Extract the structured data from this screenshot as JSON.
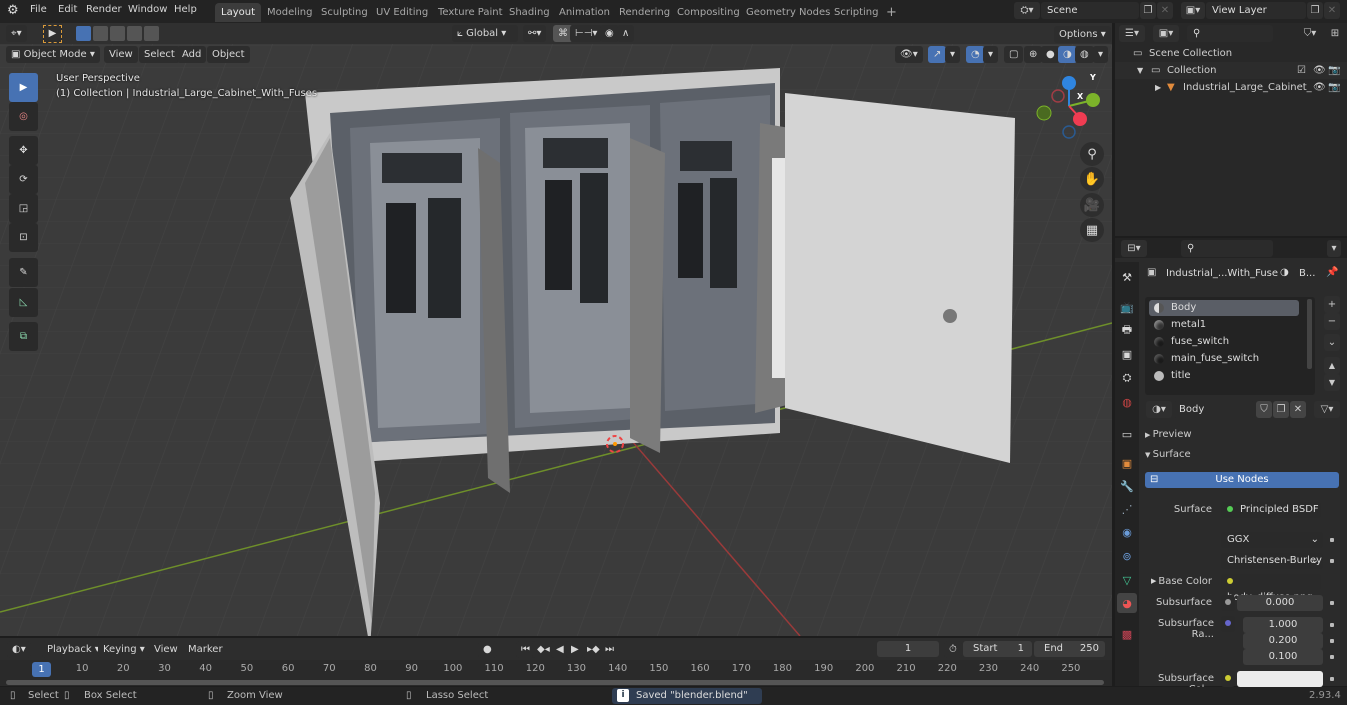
{
  "menubar": {
    "items": [
      "File",
      "Edit",
      "Render",
      "Window",
      "Help"
    ],
    "workspaces": [
      "Layout",
      "Modeling",
      "Sculpting",
      "UV Editing",
      "Texture Paint",
      "Shading",
      "Animation",
      "Rendering",
      "Compositing",
      "Geometry Nodes",
      "Scripting"
    ],
    "active_workspace": "Layout",
    "add_workspace": "+",
    "scene_name": "Scene",
    "view_layer": "View Layer"
  },
  "viewport": {
    "mode": "Object Mode",
    "menus": [
      "View",
      "Select",
      "Add",
      "Object"
    ],
    "orientation": "Global",
    "options_label": "Options",
    "overlay_title": "User Perspective",
    "overlay_subtitle": "(1) Collection | Industrial_Large_Cabinet_With_Fuses",
    "gizmo_axes": {
      "x": "X",
      "y": "Y",
      "z": "Z"
    },
    "axis_colors": {
      "x": "#f03c52",
      "y": "#7cb32a",
      "z": "#2f85e0"
    }
  },
  "outliner": {
    "root": "Scene Collection",
    "collection": "Collection",
    "object": "Industrial_Large_Cabinet_"
  },
  "properties": {
    "object_name": "Industrial_...With_Fuse",
    "material_short": "B...",
    "slots": [
      {
        "name": "Body",
        "selected": true
      },
      {
        "name": "metal1",
        "selected": false
      },
      {
        "name": "fuse_switch",
        "selected": false
      },
      {
        "name": "main_fuse_switch",
        "selected": false
      },
      {
        "name": "title",
        "selected": false
      }
    ],
    "material_name": "Body",
    "panels": {
      "preview": "Preview",
      "surface": "Surface"
    },
    "use_nodes": "Use Nodes",
    "fields": {
      "surface_label": "Surface",
      "surface_value": "Principled BSDF",
      "distribution": "GGX",
      "subsurface_method": "Christensen-Burley",
      "base_color_label": "Base Color",
      "base_color_value": "body_diffuse.png",
      "subsurface_label": "Subsurface",
      "subsurface_value": "0.000",
      "subsurface_radius_label": "Subsurface Ra...",
      "subsurface_radius": [
        "1.000",
        "0.200",
        "0.100"
      ],
      "subsurface_color_label": "Subsurface Col..."
    },
    "accent": "#4772b3"
  },
  "timeline": {
    "menus": [
      "Playback",
      "Keying",
      "View",
      "Marker"
    ],
    "current_frame": "1",
    "start_label": "Start",
    "start": "1",
    "end_label": "End",
    "end": "250",
    "ticks": [
      "1",
      "10",
      "20",
      "30",
      "40",
      "50",
      "60",
      "70",
      "80",
      "90",
      "100",
      "110",
      "120",
      "130",
      "140",
      "150",
      "160",
      "170",
      "180",
      "190",
      "200",
      "210",
      "220",
      "230",
      "240",
      "250"
    ]
  },
  "statusbar": {
    "select": "Select",
    "box_select": "Box Select",
    "zoom_view": "Zoom View",
    "lasso_select": "Lasso Select",
    "message": "Saved \"blender.blend\"",
    "version": "2.93.4"
  }
}
